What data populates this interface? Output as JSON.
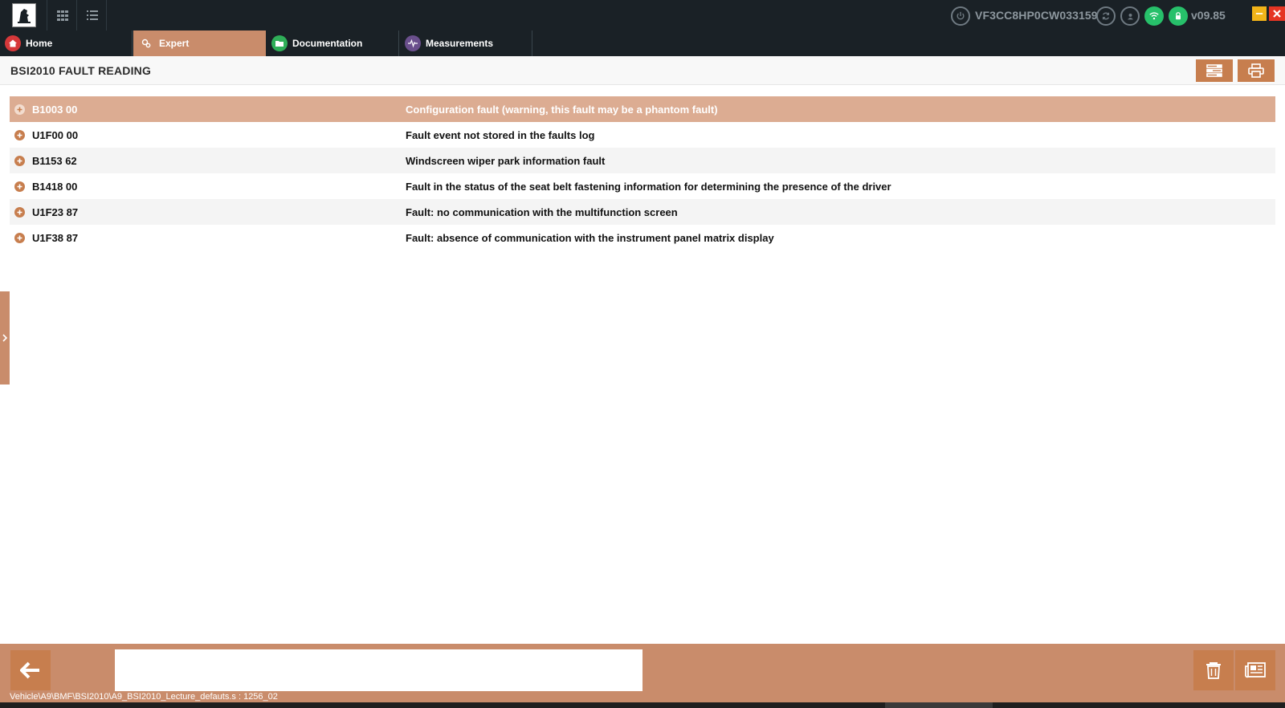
{
  "topbar": {
    "logo_icon": "peugeot-lion-logo",
    "vin": "VF3CC8HP0CW033159",
    "version": "v09.85",
    "status_icons": [
      "power-icon",
      "sync-icon",
      "user-icon",
      "wifi-icon",
      "lock-icon"
    ],
    "status_color_ok": "#27c06a"
  },
  "tabs": [
    {
      "label": "Home",
      "icon": "home-icon",
      "icon_color": "#d6383a",
      "active": false
    },
    {
      "label": "Expert",
      "icon": "gears-icon",
      "icon_color": "#c98c6b",
      "active": true
    },
    {
      "label": "Documentation",
      "icon": "folder-icon",
      "icon_color": "#2fae58",
      "active": false
    },
    {
      "label": "Measurements",
      "icon": "waveform-icon",
      "icon_color": "#6a4f8c",
      "active": false
    }
  ],
  "page": {
    "title": "BSI2010 FAULT READING"
  },
  "faults": [
    {
      "code": "B1003 00",
      "description": "Configuration fault (warning, this fault may be a phantom fault)",
      "selected": true
    },
    {
      "code": "U1F00 00",
      "description": "Fault event not stored in the faults log",
      "selected": false
    },
    {
      "code": "B1153 62",
      "description": "Windscreen wiper park information fault",
      "selected": false
    },
    {
      "code": "B1418 00",
      "description": "Fault in the status of the seat belt fastening information for determining the presence of the driver",
      "selected": false
    },
    {
      "code": "U1F23 87",
      "description": "Fault: no communication with the multifunction screen",
      "selected": false
    },
    {
      "code": "U1F38 87",
      "description": "Fault: absence of communication with the instrument panel matrix display",
      "selected": false
    }
  ],
  "footer": {
    "script_path": "Vehicle\\A9\\BMF\\BSI2010\\A9_BSI2010_Lecture_defauts.s : 1256_02"
  },
  "colors": {
    "accent": "#c77e4e",
    "accent_light": "#c98c6b",
    "selected_row": "#dcac92",
    "topbar_bg": "#1a2126"
  }
}
